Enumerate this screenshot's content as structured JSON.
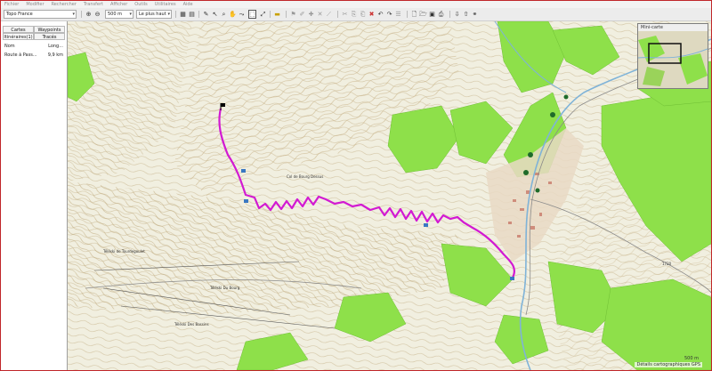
{
  "menu": [
    "Fichier",
    "Modifier",
    "Rechercher",
    "Transfert",
    "Afficher",
    "Outils",
    "Utilitaires",
    "Aide"
  ],
  "toolbar": {
    "product_select": "Topo France",
    "zoom_select": "500 m",
    "detail_select": "Le plus haut",
    "icons": [
      "zoom-in-icon",
      "zoom-out-icon",
      "find-icon",
      "route-icon",
      "new-icon",
      "open-icon",
      "save-icon",
      "print-icon",
      "binoculars-icon"
    ]
  },
  "panel": {
    "tabs_top": [
      "Cartes",
      "Waypoints"
    ],
    "tabs_bottom": [
      "Itinéraires(1)",
      "Tracés"
    ],
    "columns": {
      "name": "Nom",
      "length": "Long..."
    },
    "rows": [
      {
        "name": "Route à Pass...",
        "length": "9,9 km"
      }
    ]
  },
  "map": {
    "minimap_title": "Mini-carte",
    "scale": "500 m",
    "credit": "Détails cartographiques GPS",
    "places": [
      "Col de Bourg Dessus",
      "Téléski de Tourdegoulet",
      "Téléski Du Bourg",
      "Téléski Des Bassins"
    ],
    "elevations": [
      "1720"
    ],
    "route_color": "#d21ad2",
    "forest_color": "#8ee04a"
  }
}
